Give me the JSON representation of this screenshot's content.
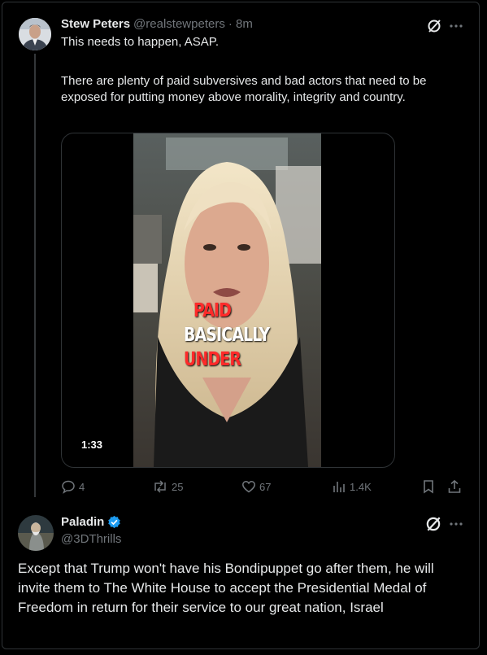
{
  "tweet": {
    "author_name": "Stew Peters",
    "handle": "@realstewpeters",
    "time": "· 8m",
    "text_line1": "This needs to happen, ASAP.",
    "text_para2": "There are plenty of paid subversives and bad actors that need to be exposed for putting money above morality, integrity and country.",
    "video": {
      "duration": "1:33",
      "captions": [
        "PAID",
        "BASICALLY",
        "UNDER"
      ],
      "caption_colors": [
        "#ff2a2a",
        "#ffffff",
        "#ff2a2a"
      ]
    },
    "actions": {
      "replies": "4",
      "reposts": "25",
      "likes": "67",
      "views": "1.4K"
    }
  },
  "reply": {
    "author_name": "Paladin",
    "handle": "@3DThrills",
    "verified": true,
    "text": "Except that Trump won't have his Bondipuppet go after them, he will invite them to The White House to accept the Presidential Medal of Freedom in return for their service to our great nation, Israel"
  },
  "colors": {
    "background": "#000000",
    "text": "#e7e9ea",
    "muted": "#71767b",
    "verified": "#1d9bf0",
    "border": "#2f3336"
  },
  "icons": [
    "grok-icon",
    "more-icon",
    "reply-icon",
    "repost-icon",
    "like-icon",
    "views-icon",
    "bookmark-icon",
    "share-icon",
    "verified-badge-icon"
  ]
}
